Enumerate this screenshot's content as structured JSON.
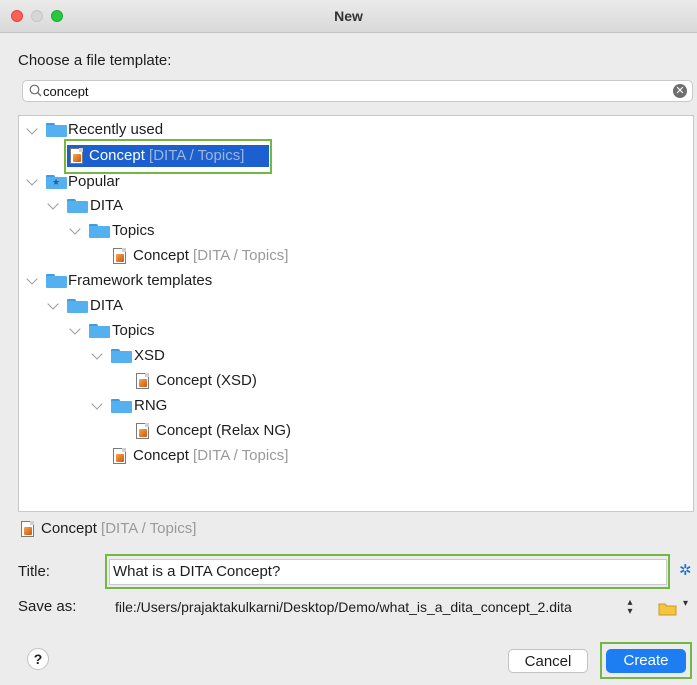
{
  "window": {
    "title": "New"
  },
  "dialog": {
    "choose_label": "Choose a file template:"
  },
  "search": {
    "value": "concept",
    "clear_icon": "clear-icon",
    "search_icon": "search-icon"
  },
  "tree": {
    "recently_used": {
      "label": "Recently used",
      "items": [
        {
          "name": "Concept",
          "path": "[DITA / Topics]"
        }
      ]
    },
    "popular": {
      "label": "Popular",
      "dita": "DITA",
      "topics": "Topics",
      "items": [
        {
          "name": "Concept",
          "path": "[DITA / Topics]"
        }
      ]
    },
    "framework": {
      "label": "Framework templates",
      "dita": "DITA",
      "topics": "Topics",
      "xsd": "XSD",
      "xsd_item": "Concept (XSD)",
      "rng": "RNG",
      "rng_item": "Concept (Relax NG)",
      "concept": {
        "name": "Concept",
        "path": "[DITA / Topics]"
      }
    }
  },
  "selection": {
    "name": "Concept",
    "path": "[DITA / Topics]"
  },
  "form": {
    "title_label": "Title:",
    "title_value": "What is a DITA Concept?",
    "save_as_label": "Save as:",
    "save_as_value": "file:/Users/prajaktakulkarni/Desktop/Demo/what_is_a_dita_concept_2.dita"
  },
  "buttons": {
    "help": "?",
    "cancel": "Cancel",
    "create": "Create"
  },
  "colors": {
    "accent": "#1d7ef3",
    "selection": "#1b5fd0",
    "highlight_box": "#72b843",
    "folder": "#55b0f0"
  }
}
